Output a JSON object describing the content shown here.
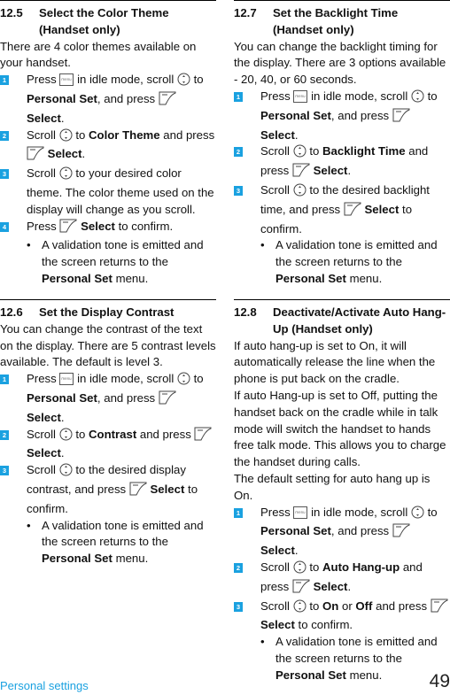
{
  "footer": {
    "section_name": "Personal settings",
    "page_number": "49"
  },
  "sections": {
    "s125": {
      "number": "12.5",
      "title": "Select the Color Theme (Handset only)",
      "intro": "There are 4 color themes available on your handset.",
      "steps": [
        {
          "badge": "1",
          "p1": "Press",
          "p2": "in idle mode, scroll",
          "p3": "to",
          "b1": "Personal Set",
          "p4": ", and press",
          "b2": "Select",
          "p5": "."
        },
        {
          "badge": "2",
          "p1": "Scroll",
          "p2": "to",
          "b1": "Color Theme",
          "p3": "and press",
          "b2": "Select",
          "p4": "."
        },
        {
          "badge": "3",
          "p1": "Scroll",
          "p2": "to your desired color theme. The color theme used on the display will change as you scroll."
        },
        {
          "badge": "4",
          "p1": "Press",
          "b1": "Select",
          "p2": "to confirm."
        }
      ],
      "bullet": {
        "t1": "A validation tone is emitted and the screen returns to the",
        "b1": "Personal Set",
        "t2": "menu."
      }
    },
    "s126": {
      "number": "12.6",
      "title": "Set the Display Contrast",
      "intro": "You can change the contrast of the text on the display. There are 5 contrast levels available. The default is level 3.",
      "steps": [
        {
          "badge": "1",
          "p1": "Press",
          "p2": "in idle mode, scroll",
          "p3": "to",
          "b1": "Personal Set",
          "p4": ", and press",
          "b2": "Select",
          "p5": "."
        },
        {
          "badge": "2",
          "p1": "Scroll",
          "p2": "to",
          "b1": "Contrast",
          "p3": "and press",
          "b2": "Select",
          "p4": "."
        },
        {
          "badge": "3",
          "p1": "Scroll",
          "p2": "to the desired display contrast, and press",
          "b1": "Select",
          "p3": "to confirm."
        }
      ],
      "bullet": {
        "t1": "A validation tone is emitted and the screen returns to the",
        "b1": "Personal Set",
        "t2": "menu."
      }
    },
    "s127": {
      "number": "12.7",
      "title": "Set the Backlight Time (Handset only)",
      "intro": "You can change the backlight timing for the display. There are 3 options available - 20, 40, or 60 seconds.",
      "steps": [
        {
          "badge": "1",
          "p1": "Press",
          "p2": "in idle mode, scroll",
          "p3": "to",
          "b1": "Personal Set",
          "p4": ", and press",
          "b2": "Select",
          "p5": "."
        },
        {
          "badge": "2",
          "p1": "Scroll",
          "p2": "to",
          "b1": "Backlight Time",
          "p3": "and press",
          "b2": "Select",
          "p4": "."
        },
        {
          "badge": "3",
          "p1": "Scroll",
          "p2": "to the desired backlight time, and press",
          "b1": "Select",
          "p3": "to confirm."
        }
      ],
      "bullet": {
        "t1": "A validation tone is emitted and the screen returns to the",
        "b1": "Personal Set",
        "t2": "menu."
      }
    },
    "s128": {
      "number": "12.8",
      "title": "Deactivate/Activate Auto Hang-Up (Handset only)",
      "intro1": "If auto hang-up is set to On, it will automatically release the line when the phone is put back on the cradle.",
      "intro2": "If auto Hang-up is set to Off, putting the handset back on the cradle while in talk mode will switch the handset to hands free talk mode. This allows you to charge the handset during calls.",
      "intro3": "The default setting for auto hang up is On.",
      "steps": [
        {
          "badge": "1",
          "p1": "Press",
          "p2": "in idle mode, scroll",
          "p3": "to",
          "b1": "Personal Set",
          "p4": ", and press",
          "b2": "Select",
          "p5": "."
        },
        {
          "badge": "2",
          "p1": "Scroll",
          "p2": "to",
          "b1": "Auto Hang-up",
          "p3": "and press",
          "b2": "Select",
          "p4": "."
        },
        {
          "badge": "3",
          "p1": "Scroll",
          "p2": "to",
          "b1": "On",
          "p3": "or",
          "b2": "Off",
          "p4": "and press",
          "b3": "Select",
          "p5": "to confirm."
        }
      ],
      "bullet": {
        "t1": "A validation tone is emitted and the screen returns to the",
        "b1": "Personal Set",
        "t2": "menu."
      }
    }
  },
  "icons": {
    "menu_key": "menu-key-icon",
    "nav_key": "navigation-key-icon",
    "softkey": "left-softkey-icon"
  },
  "colors": {
    "accent": "#1aa1e0",
    "text": "#111111"
  }
}
